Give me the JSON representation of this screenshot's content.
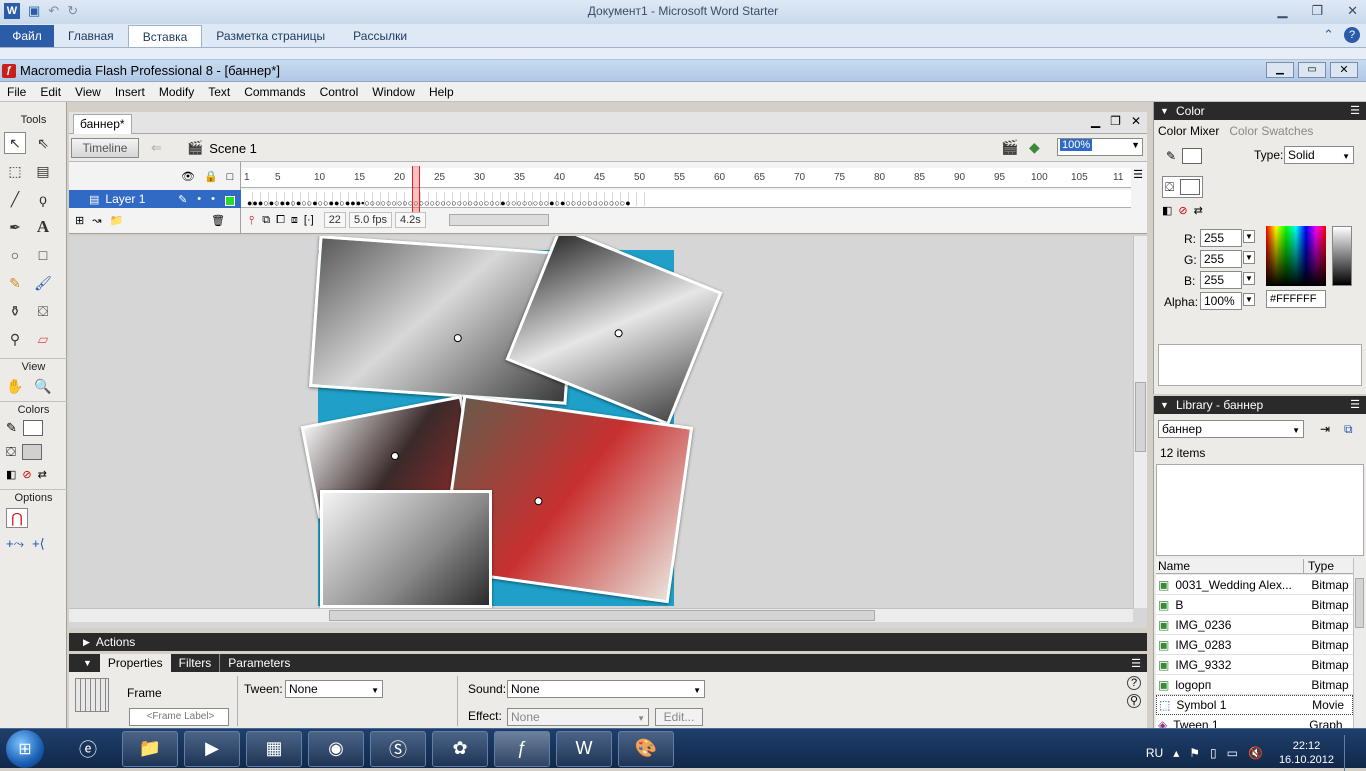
{
  "word": {
    "title": "Документ1  -  Microsoft Word Starter",
    "tabs": [
      "Файл",
      "Главная",
      "Вставка",
      "Разметка страницы",
      "Рассылки"
    ],
    "active_tab": "Вставка"
  },
  "flash": {
    "title": "Macromedia Flash Professional 8 - [баннер*]",
    "menu": [
      "File",
      "Edit",
      "View",
      "Insert",
      "Modify",
      "Text",
      "Commands",
      "Control",
      "Window",
      "Help"
    ]
  },
  "tools": {
    "title": "Tools",
    "view_label": "View",
    "colors_label": "Colors",
    "options_label": "Options"
  },
  "document": {
    "tab_label": "баннер*",
    "timeline_button": "Timeline",
    "scene": "Scene 1",
    "zoom": "100%"
  },
  "timeline": {
    "layer_name": "Layer 1",
    "ruler_ticks": [
      "1",
      "5",
      "10",
      "15",
      "20",
      "25",
      "30",
      "35",
      "40",
      "45",
      "50",
      "55",
      "60",
      "65",
      "70",
      "75",
      "80",
      "85",
      "90",
      "95",
      "100",
      "105",
      "11"
    ],
    "current_frame": "22",
    "fps": "5.0 fps",
    "elapsed": "4.2s"
  },
  "panels": {
    "actions": "Actions",
    "properties_tabs": [
      "Properties",
      "Filters",
      "Parameters"
    ],
    "frame_label": "Frame",
    "frame_label_placeholder": "<Frame Label>",
    "tween_label": "Tween:",
    "tween_value": "None",
    "sound_label": "Sound:",
    "sound_value": "None",
    "effect_label": "Effect:",
    "effect_value": "None",
    "edit_button": "Edit..."
  },
  "color_mixer": {
    "title": "Color",
    "tabs": [
      "Color Mixer",
      "Color Swatches"
    ],
    "type_label": "Type:",
    "type_value": "Solid",
    "r_label": "R:",
    "r": "255",
    "g_label": "G:",
    "g": "255",
    "b_label": "B:",
    "b": "255",
    "alpha_label": "Alpha:",
    "alpha": "100%",
    "hex": "#FFFFFF"
  },
  "library": {
    "title": "Library - баннер",
    "selector": "баннер",
    "count": "12 items",
    "col_name": "Name",
    "col_type": "Type",
    "items": [
      {
        "name": "0031_Wedding Alex...",
        "type": "Bitmap"
      },
      {
        "name": "B",
        "type": "Bitmap"
      },
      {
        "name": "IMG_0236",
        "type": "Bitmap"
      },
      {
        "name": "IMG_0283",
        "type": "Bitmap"
      },
      {
        "name": "IMG_9332",
        "type": "Bitmap"
      },
      {
        "name": "logoрп",
        "type": "Bitmap"
      },
      {
        "name": "Symbol 1",
        "type": "Movie"
      },
      {
        "name": "Tween 1",
        "type": "Graph"
      }
    ]
  },
  "taskbar": {
    "lang": "RU",
    "time": "22:12",
    "date": "16.10.2012"
  },
  "colors": {
    "stage_bg": "#1ea0c9",
    "selection": "#316ac5",
    "playhead": "#e02020"
  }
}
